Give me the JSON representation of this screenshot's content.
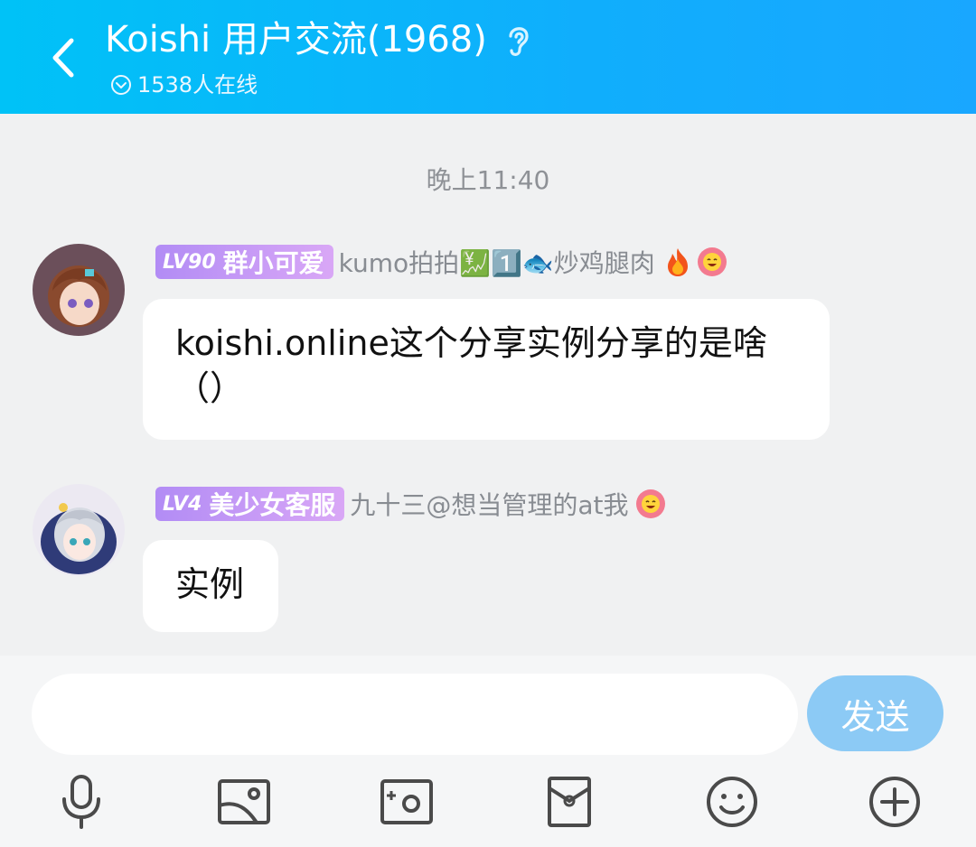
{
  "header": {
    "title": "Koishi 用户交流(1968)",
    "online": "1538人在线"
  },
  "chat": {
    "timestamp": "晚上11:40",
    "messages": [
      {
        "level": "LV90",
        "title": "群小可爱",
        "sender": "kumo拍拍💹1️⃣🐟炒鸡腿肉",
        "text": "koishi.online这个分享实例分享的是啥（）"
      },
      {
        "level": "LV4",
        "title": "美少女客服",
        "sender": "九十三@想当管理的at我",
        "text": "实例"
      }
    ]
  },
  "composer": {
    "input_value": "",
    "send_label": "发送"
  },
  "toolbar": {
    "icons": [
      "microphone-icon",
      "image-icon",
      "camera-icon",
      "red-packet-icon",
      "emoji-icon",
      "plus-icon"
    ]
  },
  "colors": {
    "header_start": "#00c2f7",
    "header_end": "#19a7ff",
    "badge_start": "#b28cf5",
    "badge_end": "#d9a7f6",
    "send_button": "#8ccaf5",
    "chat_bg": "#f0f1f2"
  }
}
